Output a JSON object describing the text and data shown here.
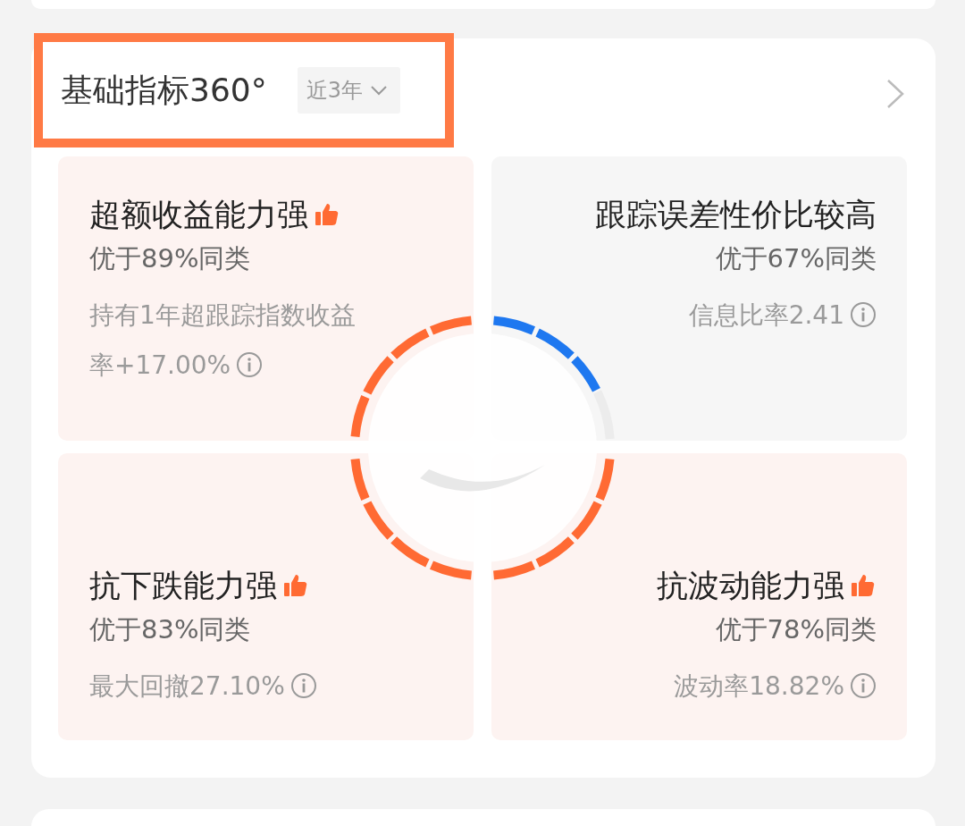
{
  "header": {
    "title": "基础指标360°",
    "period": "近3年"
  },
  "metrics": [
    {
      "title": "超额收益能力强",
      "highlight": true,
      "summary": "优于89%同类",
      "detail": "持有1年超跟踪指数收益率+17.00%"
    },
    {
      "title": "跟踪误差性价比较高",
      "highlight": false,
      "summary": "优于67%同类",
      "detail": "信息比率2.41"
    },
    {
      "title": "抗下跌能力强",
      "highlight": true,
      "summary": "优于83%同类",
      "detail": "最大回撤27.10%"
    },
    {
      "title": "抗波动能力强",
      "highlight": true,
      "summary": "优于78%同类",
      "detail": "波动率18.82%"
    }
  ]
}
